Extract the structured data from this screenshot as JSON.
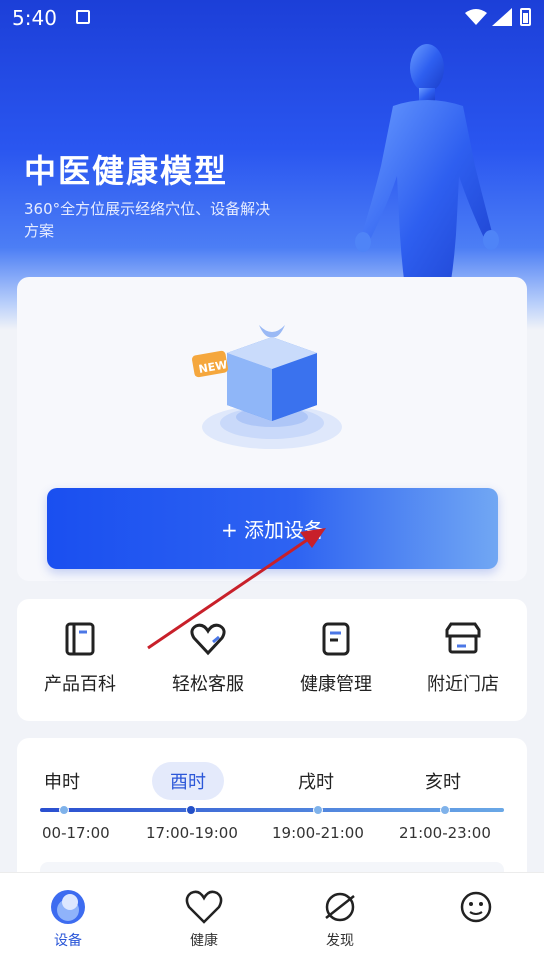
{
  "status_bar": {
    "time": "5:40"
  },
  "hero": {
    "title": "中医健康模型",
    "subtitle": "360°全方位展示经络穴位、设备解决方案"
  },
  "device_card": {
    "badge": "NEW",
    "add_button": "+ 添加设备"
  },
  "quick_links": [
    {
      "label": "产品百科",
      "icon": "book-icon"
    },
    {
      "label": "轻松客服",
      "icon": "heart-icon"
    },
    {
      "label": "健康管理",
      "icon": "document-icon"
    },
    {
      "label": "附近门店",
      "icon": "store-icon"
    }
  ],
  "timeline": {
    "periods": [
      {
        "name": "申时",
        "range": "00-17:00"
      },
      {
        "name": "酉时",
        "range": "17:00-19:00",
        "active": true
      },
      {
        "name": "戌时",
        "range": "19:00-21:00"
      },
      {
        "name": "亥时",
        "range": "21:00-23:00"
      }
    ]
  },
  "tabbar": {
    "items": [
      {
        "label": "设备",
        "icon": "device-icon",
        "active": true
      },
      {
        "label": "健康",
        "icon": "heart-icon"
      },
      {
        "label": "发现",
        "icon": "compass-icon"
      },
      {
        "label": "",
        "icon": "smile-icon"
      }
    ]
  },
  "colors": {
    "accent": "#2b57d8",
    "hero_top": "#1c3fd8",
    "arrow": "#c8202a"
  }
}
